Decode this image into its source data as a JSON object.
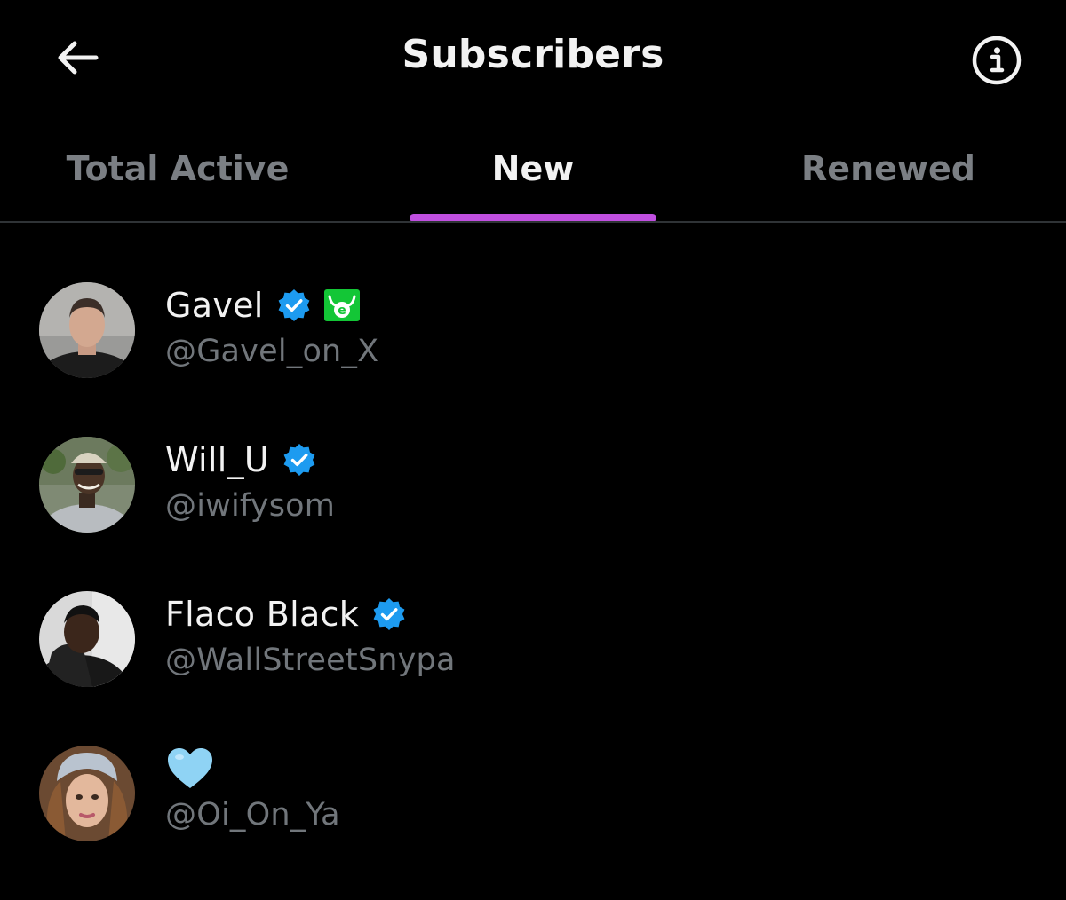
{
  "header": {
    "title": "Subscribers",
    "back_icon": "arrow-left-icon",
    "info_icon": "info-circle-icon"
  },
  "tabs": [
    {
      "label": "Total Active",
      "active": false
    },
    {
      "label": "New",
      "active": true
    },
    {
      "label": "Renewed",
      "active": false
    }
  ],
  "colors": {
    "background": "#000000",
    "tab_indicator": "#c04fe0",
    "verified_badge": "#1d9bf0",
    "handle_text": "#71767b",
    "heart": "#8fd3f4"
  },
  "subscribers": [
    {
      "name": "Gavel",
      "handle": "@Gavel_on_X",
      "verified": true,
      "extra_badge": "etoro-badge-icon"
    },
    {
      "name": "Will_U",
      "handle": "@iwifysom",
      "verified": true
    },
    {
      "name": "Flaco Black",
      "handle": "@WallStreetSnypa",
      "verified": true
    },
    {
      "name": "",
      "name_icon": "light-blue-heart-icon",
      "handle": "@Oi_On_Ya",
      "verified": false
    }
  ]
}
